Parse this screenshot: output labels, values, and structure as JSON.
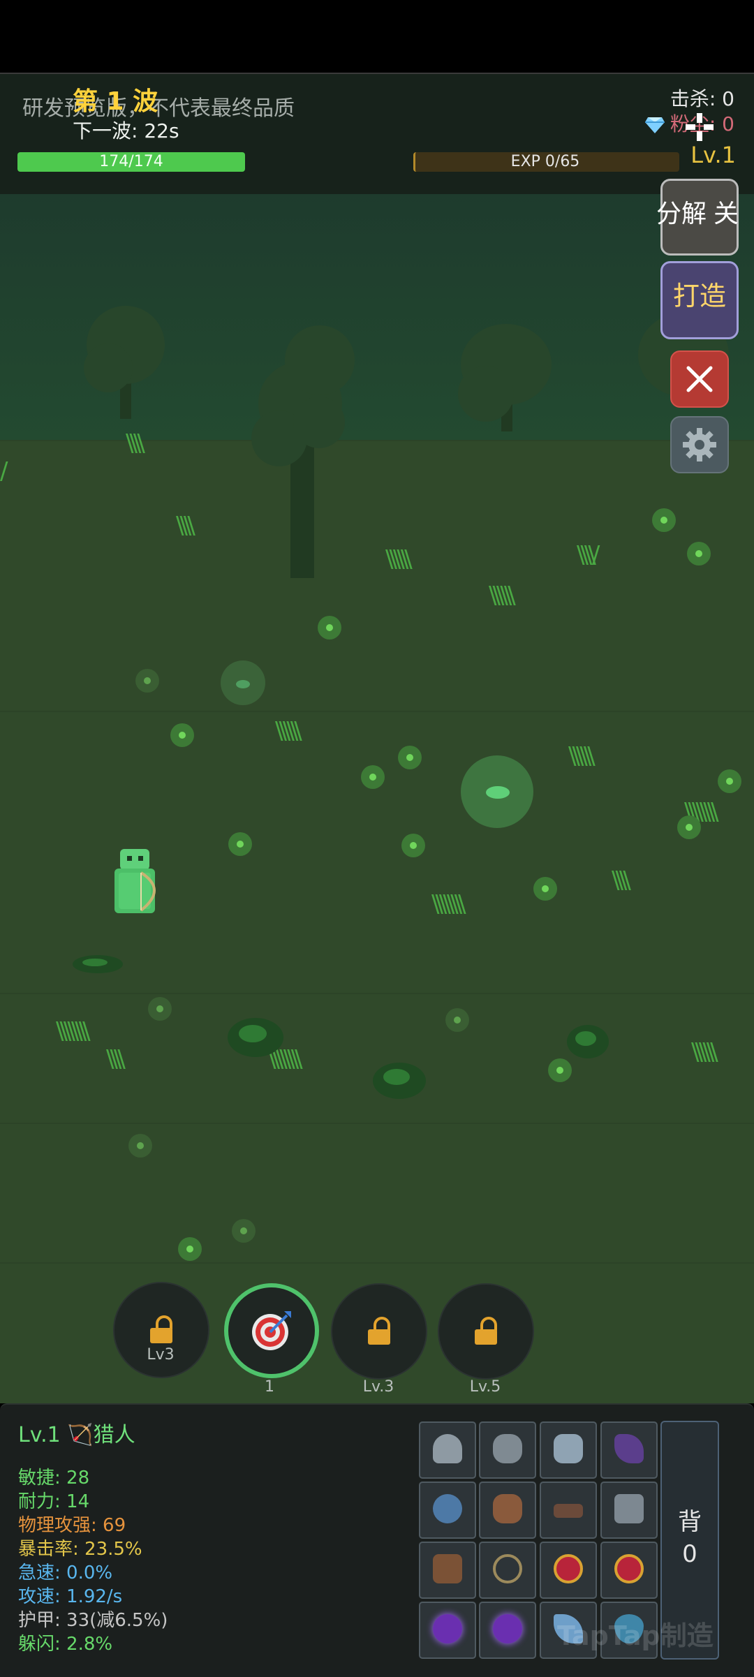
{
  "hud": {
    "wave_title": "第 1 波",
    "next_wave": "下一波: 22s",
    "preview_notice": "研发预览版，不代表最终品质",
    "kills": "击杀: 0",
    "dust": "粉尘: 0",
    "level": "Lv.1",
    "hp_text": "174/174",
    "hp_ratio": 1.0,
    "exp_text": "EXP 0/65",
    "exp_ratio": 0.0
  },
  "side_buttons": {
    "decompose": "分解 关",
    "craft": "打造"
  },
  "skills": [
    {
      "label": "Lv3",
      "state": "locked"
    },
    {
      "label": "1",
      "state": "active"
    },
    {
      "label": "Lv.3",
      "state": "locked"
    },
    {
      "label": "Lv.5",
      "state": "locked"
    }
  ],
  "character": {
    "title": "Lv.1 🏹猎人",
    "stats": {
      "agility": "敏捷: 28",
      "stamina": "耐力: 14",
      "phys_power": "物理攻强: 69",
      "crit": "暴击率: 23.5%",
      "haste": "急速: 0.0%",
      "atk_speed": "攻速: 1.92/s",
      "armor": "护甲: 33(减6.5%)",
      "dodge": "躲闪: 2.8%"
    },
    "bag": {
      "label": "背",
      "count": "0"
    }
  },
  "watermark": "TapTap制造",
  "colors": {
    "wave_title": "#ffd23c",
    "hp": "#4ec94e",
    "level": "#e8c341",
    "agility": "#67d96a",
    "stamina": "#67d96a",
    "phys": "#e6933d",
    "crit": "#e3c64a",
    "haste": "#59b6ee",
    "atk_speed": "#59b6ee",
    "armor": "#c6c6c6",
    "dodge": "#67d96a"
  },
  "icons": {
    "equipment": [
      "helmet-icon",
      "shoulders-icon",
      "chest-armor-icon",
      "cloak-icon",
      "bracers-icon",
      "gloves-icon",
      "belt-icon",
      "leg-armor-icon",
      "boots-icon",
      "amulet-icon",
      "ring-icon",
      "ring-icon",
      "orb-icon",
      "orb-icon",
      "sword-icon",
      "shield-icon"
    ]
  }
}
